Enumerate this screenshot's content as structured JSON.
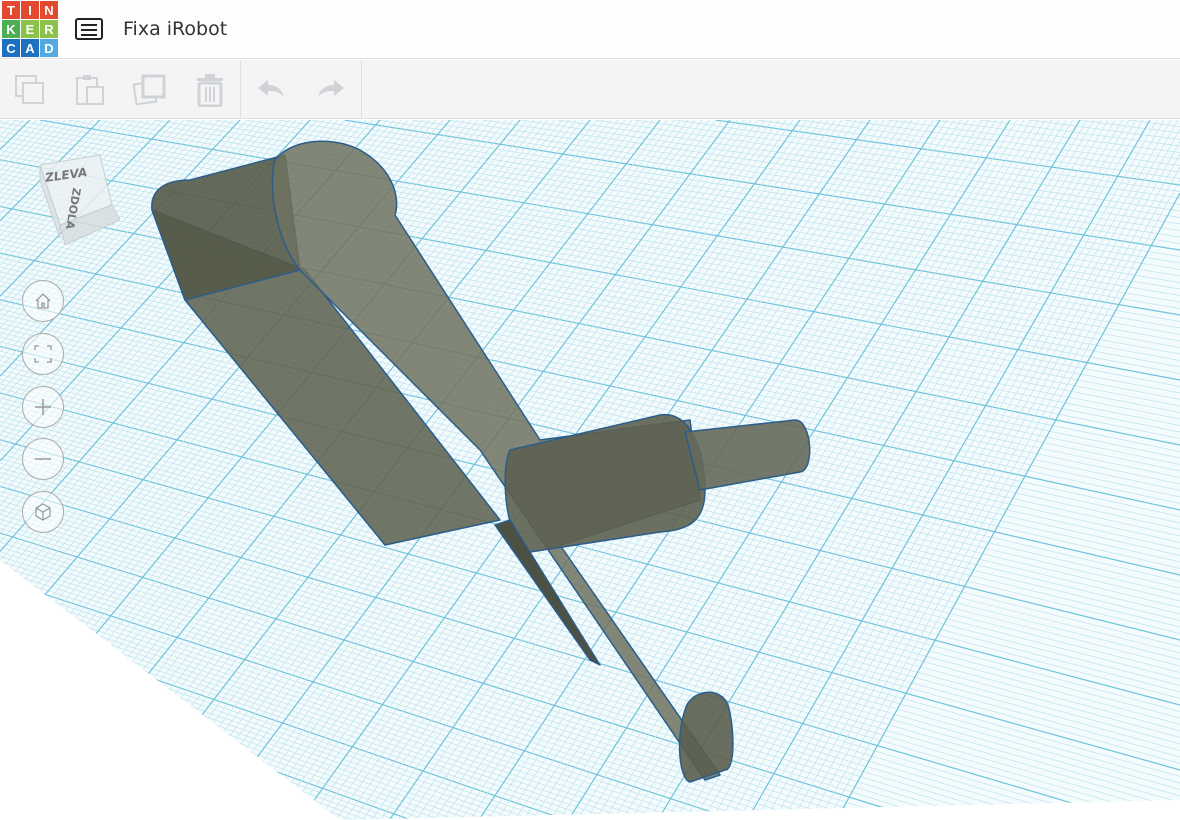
{
  "logo": {
    "letters": [
      "T",
      "I",
      "N",
      "K",
      "E",
      "R",
      "C",
      "A",
      "D"
    ],
    "colors": [
      "#e2492f",
      "#e2492f",
      "#e2492f",
      "#4caf50",
      "#8bc34a",
      "#8bc34a",
      "#1e70c1",
      "#1e70c1",
      "#53a8e0"
    ]
  },
  "header": {
    "title": "Fixa iRobot",
    "menu_icon": "list-icon"
  },
  "toolbar": {
    "buttons": [
      "copy",
      "paste",
      "duplicate",
      "delete",
      "undo",
      "redo"
    ]
  },
  "viewcube": {
    "front": "ZLEVA",
    "bottom": "ZDOLA"
  },
  "nav": [
    "home",
    "fit",
    "zoom-in",
    "zoom-out",
    "ortho"
  ],
  "colors": {
    "model": "#6b6e5e",
    "outline": "#2c5d8a",
    "grid_minor": "#bfe3ee",
    "grid_major": "#6ec3dc"
  }
}
